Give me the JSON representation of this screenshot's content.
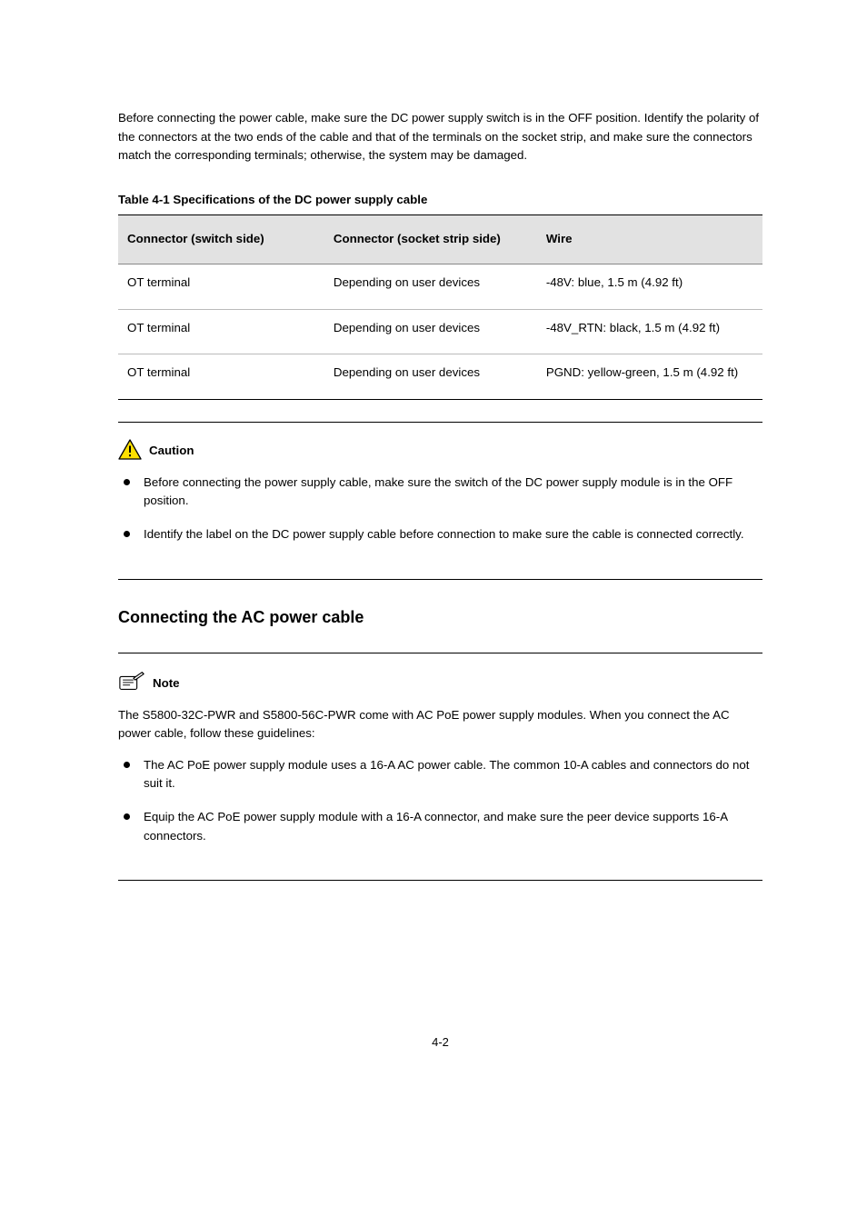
{
  "intro_para": "Before connecting the power cable, make sure the DC power supply switch is in the OFF position. Identify the polarity of the connectors at the two ends of the cable and that of the terminals on the socket strip, and make sure the connectors match the corresponding terminals; otherwise, the system may be damaged.",
  "table_caption": "Table 4-1 Specifications of the DC power supply cable",
  "table": {
    "headers": [
      "Connector (switch side)",
      "Connector (socket strip side)",
      "Wire"
    ],
    "rows": [
      [
        "OT terminal",
        "Depending on user devices",
        "-48V: blue, 1.5 m (4.92 ft)"
      ],
      [
        "OT terminal",
        "Depending on user devices",
        "-48V_RTN: black, 1.5 m (4.92 ft)"
      ],
      [
        "OT terminal",
        "Depending on user devices",
        "PGND: yellow-green, 1.5 m (4.92 ft)"
      ]
    ]
  },
  "caution": {
    "label": "Caution",
    "items": [
      "Before connecting the power supply cable, make sure the switch of the DC power supply module is in the OFF position.",
      "Identify the label on the DC power supply cable before connection to make sure the cable is connected correctly."
    ]
  },
  "section_title": "Connecting the AC power cable",
  "note": {
    "label": "Note",
    "intro": "The S5800-32C-PWR and S5800-56C-PWR come with AC PoE power supply modules. When you connect the AC power cable, follow these guidelines:",
    "items": [
      "The AC PoE power supply module uses a 16-A AC power cable. The common 10-A cables and connectors do not suit it.",
      "Equip the AC PoE power supply module with a 16-A connector, and make sure the peer device supports 16-A connectors."
    ]
  },
  "page_number": "4-2"
}
